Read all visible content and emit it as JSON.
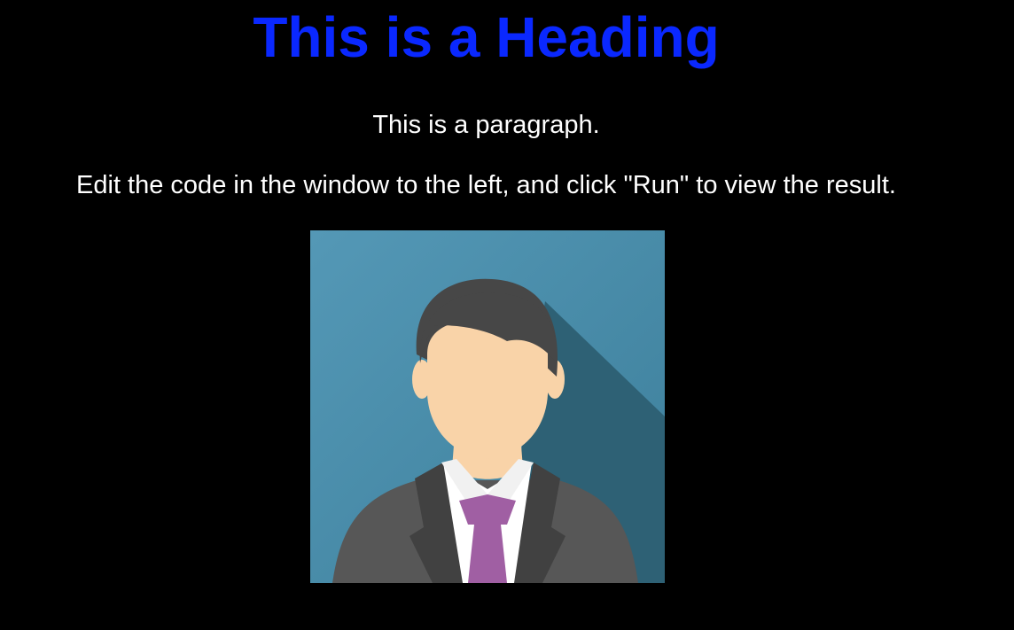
{
  "heading": "This is a Heading",
  "paragraph": "This is a paragraph.",
  "instructions": "Edit the code in the window to the left, and click \"Run\" to view the result.",
  "image": {
    "alt": "avatar-businessman"
  },
  "colors": {
    "background": "#000000",
    "heading": "#0a28ff",
    "text": "#ffffff",
    "avatar_bg": "#4b8eaa",
    "avatar_shadow": "#2e6175",
    "skin": "#f9d3a8",
    "hair": "#474747",
    "suit": "#575757",
    "tie": "#a05fa3"
  }
}
